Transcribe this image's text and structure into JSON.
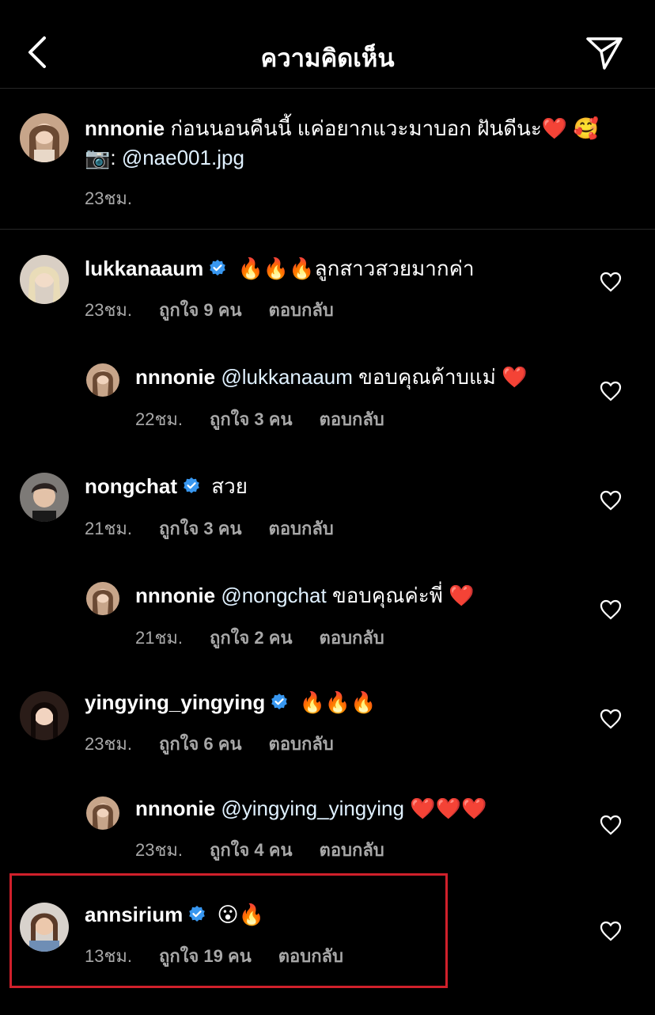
{
  "header": {
    "title": "ความคิดเห็น",
    "back_icon": "chevron-left-icon",
    "send_icon": "paper-plane-icon"
  },
  "caption": {
    "username": "nnnonie",
    "text": " ก่อนนอนคืนนี้ แค่อยากแวะมาบอก ฝันดีนะ❤️ 🥰",
    "camera_emoji": "📷",
    "credit_prefix": ": ",
    "credit_mention": "@nae001.jpg",
    "time": "23ชม."
  },
  "comments": [
    {
      "username": "lukkanaaum",
      "verified": true,
      "text": " 🔥🔥🔥ลูกสาวสวยมากค่า",
      "time": "23ชม.",
      "likes": "ถูกใจ 9 คน",
      "reply": "ตอบกลับ"
    },
    {
      "username": "nnnonie",
      "verified": false,
      "mention": "@lukkanaaum",
      "text": " ขอบคุณค้าบแม่ ❤️",
      "time": "22ชม.",
      "likes": "ถูกใจ 3 คน",
      "reply": "ตอบกลับ"
    },
    {
      "username": "nongchat",
      "verified": true,
      "text": " สวย",
      "time": "21ชม.",
      "likes": "ถูกใจ 3 คน",
      "reply": "ตอบกลับ"
    },
    {
      "username": "nnnonie",
      "verified": false,
      "mention": "@nongchat",
      "text": " ขอบคุณค่ะพี่ ❤️",
      "time": "21ชม.",
      "likes": "ถูกใจ 2 คน",
      "reply": "ตอบกลับ"
    },
    {
      "username": "yingying_yingying",
      "verified": true,
      "text": " 🔥🔥🔥",
      "time": "23ชม.",
      "likes": "ถูกใจ 6 คน",
      "reply": "ตอบกลับ"
    },
    {
      "username": "nnnonie",
      "verified": false,
      "mention": "@yingying_yingying",
      "text": " ❤️❤️❤️",
      "time": "23ชม.",
      "likes": "ถูกใจ 4 คน",
      "reply": "ตอบกลับ"
    },
    {
      "username": "annsirium",
      "verified": true,
      "text": " 😮🔥",
      "time": "13ชม.",
      "likes": "ถูกใจ 19 คน",
      "reply": "ตอบกลับ"
    }
  ],
  "colors": {
    "background": "#000000",
    "secondary_text": "#a8a8a8",
    "verified_blue": "#3897f0",
    "highlight_red": "#d0202b"
  }
}
